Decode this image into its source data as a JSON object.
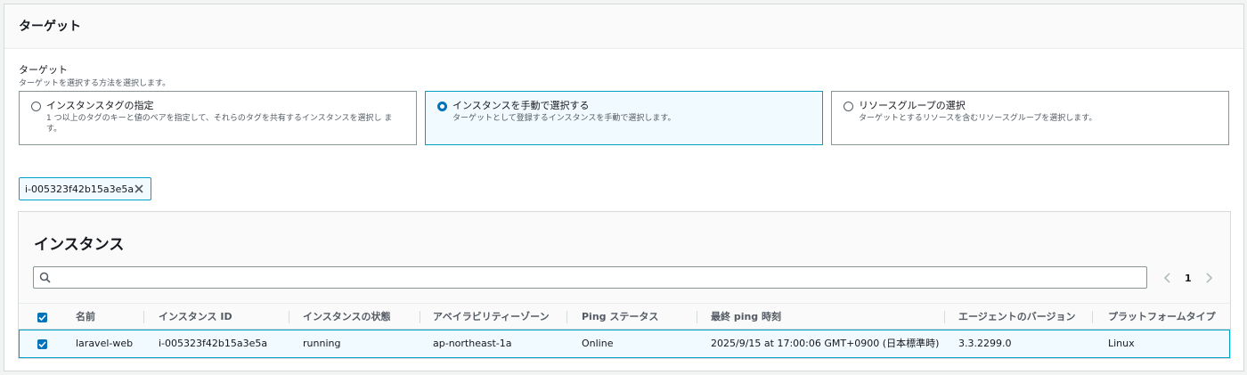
{
  "panel": {
    "title": "ターゲット"
  },
  "field": {
    "label": "ターゲット",
    "description": "ターゲットを選択する方法を選択します。"
  },
  "options": [
    {
      "title": "インスタンスタグの指定",
      "description": "1 つ以上のタグのキーと値のペアを指定して、それらのタグを共有するインスタンスを選択し ます。",
      "selected": false
    },
    {
      "title": "インスタンスを手動で選択する",
      "description": "ターゲットとして登録するインスタンスを手動で選択します。",
      "selected": true
    },
    {
      "title": "リソースグループの選択",
      "description": "ターゲットとするリソースを含むリソースグループを選択します。",
      "selected": false
    }
  ],
  "token": {
    "label": "i-005323f42b15a3e5a",
    "icon": "close-icon"
  },
  "instances": {
    "title": "インスタンス",
    "search": {
      "value": "",
      "placeholder": "",
      "icon": "search-icon"
    },
    "pagination": {
      "current": "1",
      "prev_icon": "chevron-left-icon",
      "next_icon": "chevron-right-icon"
    },
    "columns": [
      "名前",
      "インスタンス ID",
      "インスタンスの状態",
      "アベイラビリティーゾーン",
      "Ping ステータス",
      "最終 ping 時刻",
      "エージェントのバージョン",
      "プラットフォームタイプ"
    ],
    "rows": [
      {
        "selected": true,
        "cells": [
          "laravel-web",
          "i-005323f42b15a3e5a",
          "running",
          "ap-northeast-1a",
          "Online",
          "2025/9/15 at 17:00:06 GMT+0900 (日本標準時)",
          "3.3.2299.0",
          "Linux"
        ]
      }
    ]
  },
  "colors": {
    "accent": "#0073bb",
    "selected_border": "#00a1c9",
    "selected_bg": "#f1faff"
  }
}
